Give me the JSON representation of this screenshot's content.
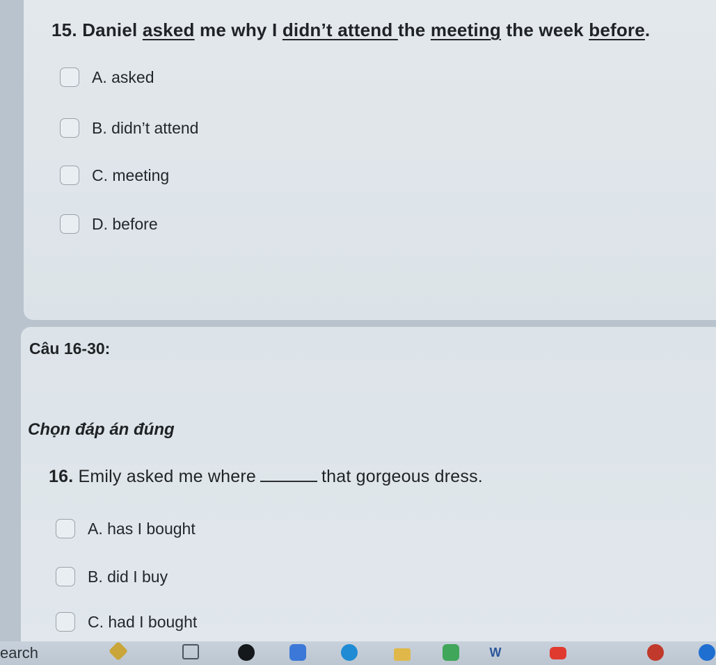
{
  "q15": {
    "number": "15.",
    "parts": [
      "Daniel ",
      "asked",
      " me why I ",
      "didn’t attend ",
      "the ",
      "meeting",
      " the week ",
      "before",
      "."
    ],
    "options": [
      {
        "label": "A. asked"
      },
      {
        "label": "B. didn’t attend"
      },
      {
        "label": "C. meeting"
      },
      {
        "label": "D. before"
      }
    ]
  },
  "section": {
    "heading": "Câu 16-30:",
    "instruction": "Chọn đáp án đúng"
  },
  "q16": {
    "number": "16.",
    "before": "Emily asked me where",
    "after": "that gorgeous dress.",
    "options": [
      {
        "label": "A. has I bought"
      },
      {
        "label": "B. did I buy"
      },
      {
        "label": "C. had I bought"
      }
    ]
  },
  "taskbar": {
    "search_text": "earch",
    "icons": [
      "copilot-icon",
      "task-view-icon",
      "tiktok-icon",
      "photos-icon",
      "edge-icon",
      "file-explorer-icon",
      "app-icon",
      "word-icon",
      "youtube-icon",
      "app-icon",
      "app-icon"
    ],
    "word_label": "W"
  }
}
